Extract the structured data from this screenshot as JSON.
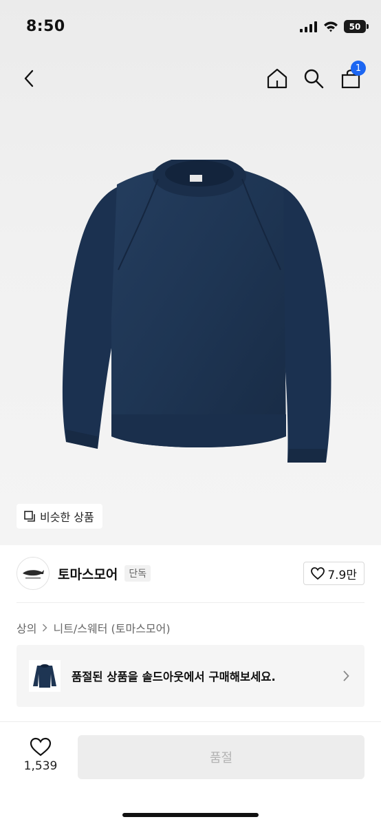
{
  "status_bar": {
    "time": "8:50",
    "battery": "50"
  },
  "nav": {
    "cart_count": "1"
  },
  "product": {
    "similar_label": "비슷한 상품"
  },
  "brand": {
    "name": "토마스모어",
    "badge": "단독",
    "likes": "7.9만"
  },
  "breadcrumb": {
    "category": "상의",
    "subcategory": "니트/스웨터 (토마스모어)"
  },
  "soldout_banner": {
    "text": "품절된 상품을 솔드아웃에서 구매해보세요."
  },
  "bottom_bar": {
    "wish_count": "1,539",
    "buy_label": "품절"
  },
  "colors": {
    "accent": "#1c66f2",
    "sweater": "#1e3553"
  }
}
